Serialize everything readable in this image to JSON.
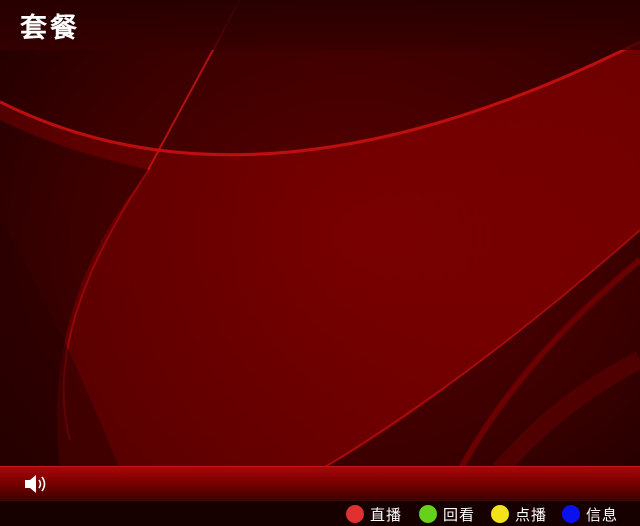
{
  "header": {
    "title": "套餐"
  },
  "status_bar": {
    "volume_icon": "speaker-volume-icon"
  },
  "color_keys": [
    {
      "label": "直播",
      "color": "#e03030"
    },
    {
      "label": "回看",
      "color": "#66d11a"
    },
    {
      "label": "点播",
      "color": "#f2e21a"
    },
    {
      "label": "信息",
      "color": "#0a10ee"
    }
  ],
  "colors": {
    "background": "#3a0000",
    "accent": "#a80808"
  }
}
